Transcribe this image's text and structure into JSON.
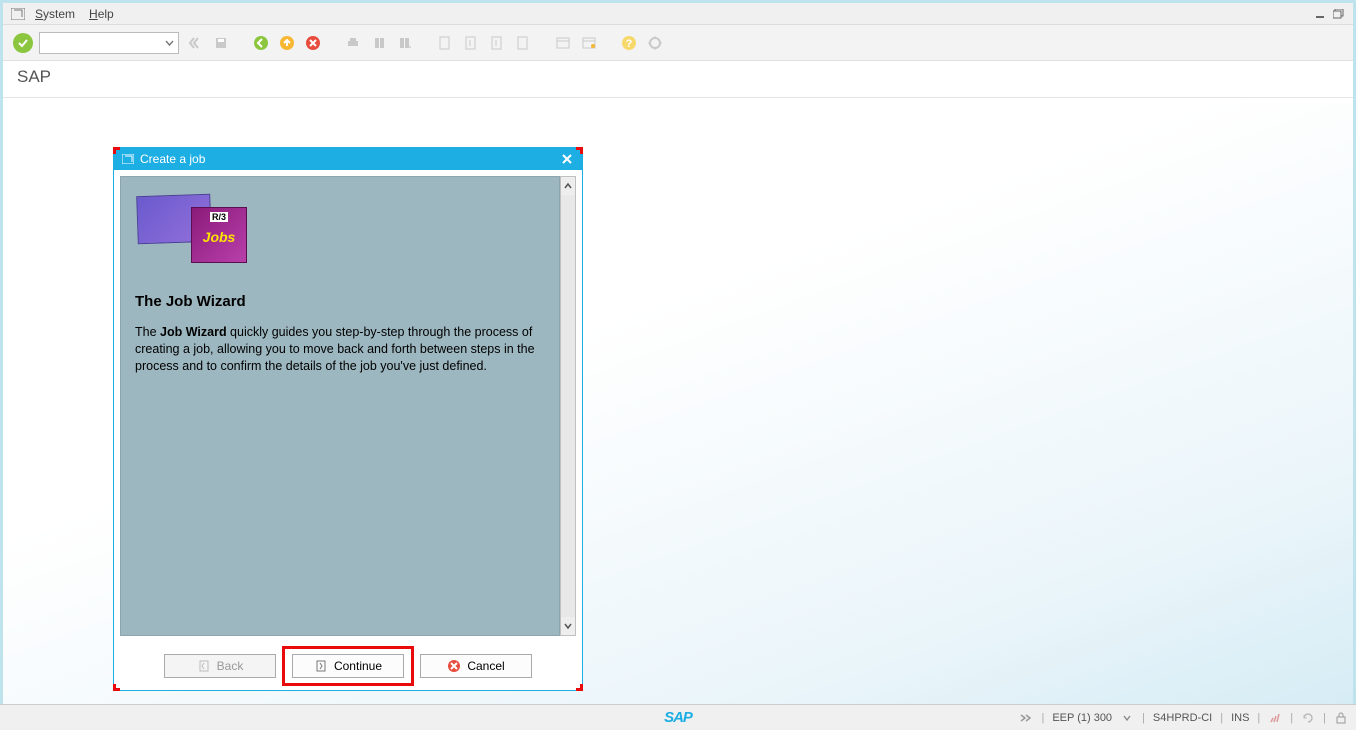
{
  "menubar": {
    "system": "System",
    "help": "Help"
  },
  "title": "SAP",
  "dialog": {
    "title": "Create a job",
    "logo_r3": "R/3",
    "logo_jobs": "Jobs",
    "heading": "The Job Wizard",
    "body_prefix": "The ",
    "body_bold": "Job Wizard",
    "body_rest": " quickly guides you step-by-step through the process of creating a job, allowing you to move back and forth between steps in the process and to confirm the details of the job you've just defined.",
    "back": "Back",
    "continue": "Continue",
    "cancel": "Cancel"
  },
  "statusbar": {
    "system": "EEP (1) 300",
    "server": "S4HPRD-CI",
    "mode": "INS"
  }
}
